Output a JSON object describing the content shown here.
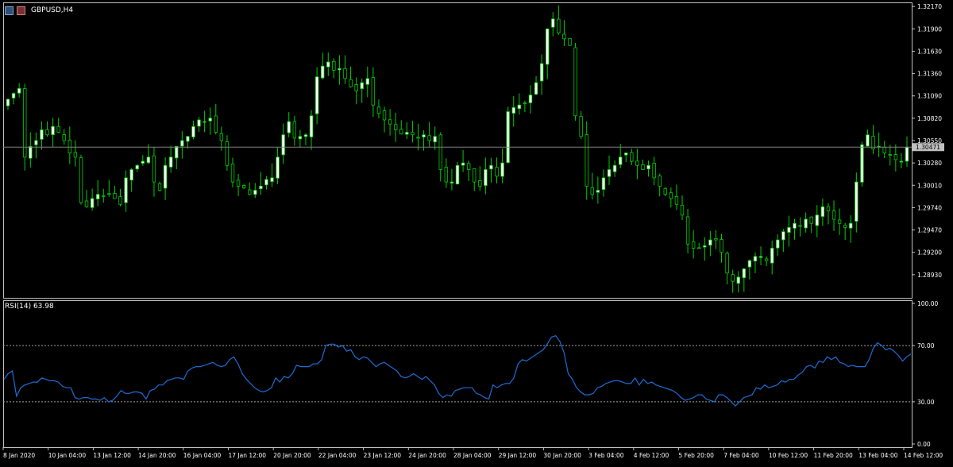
{
  "title": "GBPUSD,H4",
  "colors": {
    "background": "#000000",
    "grid_frame": "#c0c0c0",
    "bull_candle": "#ffffff",
    "bear_candle": "#000000",
    "wick": "#00d000",
    "rsi_line": "#1e6cd6",
    "current_price_line": "#808080"
  },
  "chart_data": [
    {
      "type": "candlestick",
      "title": "GBPUSD,H4",
      "y_ticks": [
        "1.32170",
        "1.31900",
        "1.31630",
        "1.31360",
        "1.31090",
        "1.30820",
        "1.30550",
        "1.30280",
        "1.30010",
        "1.29740",
        "1.29470",
        "1.29200",
        "1.28930"
      ],
      "ylim": [
        1.2865,
        1.3222
      ],
      "current_price": "1.30471",
      "x_labels": [
        "8 Jan 2020",
        "10 Jan 04:00",
        "13 Jan 12:00",
        "14 Jan 20:00",
        "16 Jan 04:00",
        "17 Jan 12:00",
        "20 Jan 20:00",
        "22 Jan 04:00",
        "23 Jan 12:00",
        "24 Jan 20:00",
        "28 Jan 04:00",
        "29 Jan 12:00",
        "30 Jan 20:00",
        "3 Feb 04:00",
        "4 Feb 12:00",
        "5 Feb 20:00",
        "7 Feb 04:00",
        "10 Feb 12:00",
        "11 Feb 20:00",
        "13 Feb 04:00",
        "14 Feb 12:00"
      ],
      "closes": [
        1.3105,
        1.3112,
        1.3118,
        1.3035,
        1.3048,
        1.3055,
        1.3068,
        1.3062,
        1.3072,
        1.3065,
        1.3055,
        1.304,
        1.3035,
        1.298,
        1.2975,
        1.2985,
        1.299,
        1.2988,
        1.299,
        1.2985,
        1.2978,
        1.301,
        1.302,
        1.3025,
        1.303,
        1.3035,
        1.3005,
        1.2995,
        1.3025,
        1.3035,
        1.3048,
        1.3055,
        1.306,
        1.3072,
        1.308,
        1.3078,
        1.3082,
        1.3065,
        1.3055,
        1.3025,
        1.3005,
        1.3,
        1.2998,
        1.299,
        1.2995,
        1.3,
        1.3008,
        1.301,
        1.3035,
        1.3062,
        1.3078,
        1.3058,
        1.306,
        1.3062,
        1.3085,
        1.3132,
        1.3145,
        1.315,
        1.314,
        1.3142,
        1.313,
        1.312,
        1.3115,
        1.3125,
        1.313,
        1.3098,
        1.3088,
        1.308,
        1.3075,
        1.3068,
        1.3063,
        1.3065,
        1.3062,
        1.3058,
        1.3062,
        1.3055,
        1.306,
        1.302,
        1.3005,
        1.3005,
        1.3025,
        1.3028,
        1.302,
        1.3005,
        1.3,
        1.302,
        1.3025,
        1.3012,
        1.3028,
        1.309,
        1.3095,
        1.3098,
        1.31,
        1.311,
        1.3125,
        1.3148,
        1.319,
        1.3202,
        1.3185,
        1.3178,
        1.317,
        1.3085,
        1.306,
        1.3,
        1.299,
        1.2995,
        1.301,
        1.302,
        1.3025,
        1.3035,
        1.304,
        1.303,
        1.3025,
        1.302,
        1.3025,
        1.301,
        1.3,
        1.299,
        1.2985,
        1.2978,
        1.2965,
        1.293,
        1.2925,
        1.2925,
        1.2928,
        1.2935,
        1.2935,
        1.292,
        1.2895,
        1.2885,
        1.289,
        1.29,
        1.291,
        1.2915,
        1.2915,
        1.291,
        1.2925,
        1.2935,
        1.2945,
        1.295,
        1.2955,
        1.2952,
        1.296,
        1.2955,
        1.2965,
        1.2975,
        1.297,
        1.296,
        1.2955,
        1.295,
        1.2955,
        1.3005,
        1.305,
        1.3062,
        1.3045,
        1.3048,
        1.304,
        1.3038,
        1.3032,
        1.303,
        1.3047
      ],
      "opens_note": ""
    },
    {
      "type": "line",
      "title": "RSI(14) 63.98",
      "y_ticks": [
        "100.00",
        "70.00",
        "30.00",
        "0.00"
      ],
      "ylim": [
        0,
        100
      ],
      "levels": [
        70,
        30
      ],
      "values": [
        46,
        50,
        52,
        34,
        40,
        42,
        43,
        44,
        44,
        47,
        46,
        45,
        45,
        44,
        41,
        40,
        40,
        33,
        32,
        33,
        33,
        32,
        32,
        31,
        33,
        30,
        31,
        34,
        38,
        36,
        36,
        37,
        37,
        36,
        32,
        38,
        39,
        42,
        42,
        45,
        46,
        47,
        47,
        46,
        52,
        54,
        55,
        55,
        56,
        57,
        58,
        56,
        55,
        56,
        60,
        62,
        57,
        50,
        46,
        43,
        40,
        38,
        37,
        38,
        40,
        47,
        44,
        48,
        47,
        50,
        56,
        55,
        55,
        55,
        57,
        57,
        60,
        70,
        71,
        71,
        69,
        70,
        66,
        67,
        62,
        60,
        62,
        61,
        58,
        55,
        57,
        58,
        56,
        54,
        52,
        48,
        47,
        48,
        50,
        48,
        46,
        48,
        45,
        42,
        36,
        33,
        35,
        34,
        38,
        39,
        40,
        40,
        40,
        36,
        35,
        33,
        32,
        42,
        40,
        42,
        43,
        43,
        47,
        57,
        60,
        59,
        61,
        63,
        65,
        67,
        71,
        76,
        77,
        73,
        65,
        50,
        46,
        40,
        37,
        35,
        35,
        36,
        40,
        41,
        43,
        44,
        45,
        45,
        44,
        43,
        43,
        47,
        42,
        46,
        43,
        44,
        42,
        41,
        40,
        39,
        38,
        36,
        33,
        31,
        32,
        33,
        35,
        35,
        32,
        31,
        30,
        35,
        35,
        33,
        30,
        27,
        30,
        33,
        34,
        35,
        40,
        39,
        42,
        40,
        41,
        42,
        45,
        44,
        46,
        46,
        49,
        51,
        55,
        56,
        54,
        59,
        58,
        62,
        60,
        62,
        58,
        57,
        55,
        56,
        55,
        55,
        55,
        60,
        68,
        72,
        70,
        67,
        68,
        66,
        63,
        59,
        62,
        64
      ]
    }
  ]
}
